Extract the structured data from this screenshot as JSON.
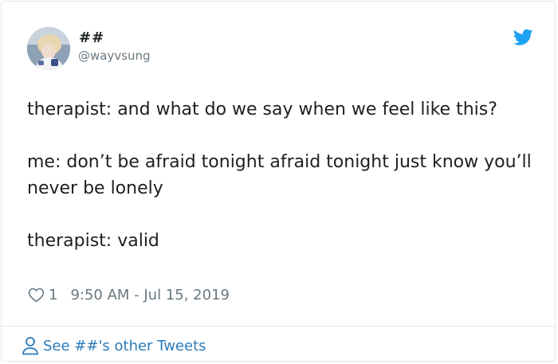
{
  "tweet": {
    "display_name": "##",
    "handle": "@wayvsung",
    "paragraphs": [
      "therapist: and what do we say when we feel like this?",
      "me: don’t be afraid tonight afraid tonight just know you’ll never be lonely",
      "therapist: valid"
    ],
    "likes": "1",
    "timestamp": "9:50 AM - Jul 15, 2019"
  },
  "footer": {
    "label": "See ##'s other Tweets"
  },
  "icons": {
    "brand": "twitter-bird-icon",
    "like": "heart-icon",
    "footer": "person-icon"
  },
  "colors": {
    "brand_blue": "#1da1f2",
    "link_blue": "#2b7bb9",
    "secondary_text": "#697882",
    "primary_text": "#1c2022",
    "border": "#e1e8ed"
  }
}
